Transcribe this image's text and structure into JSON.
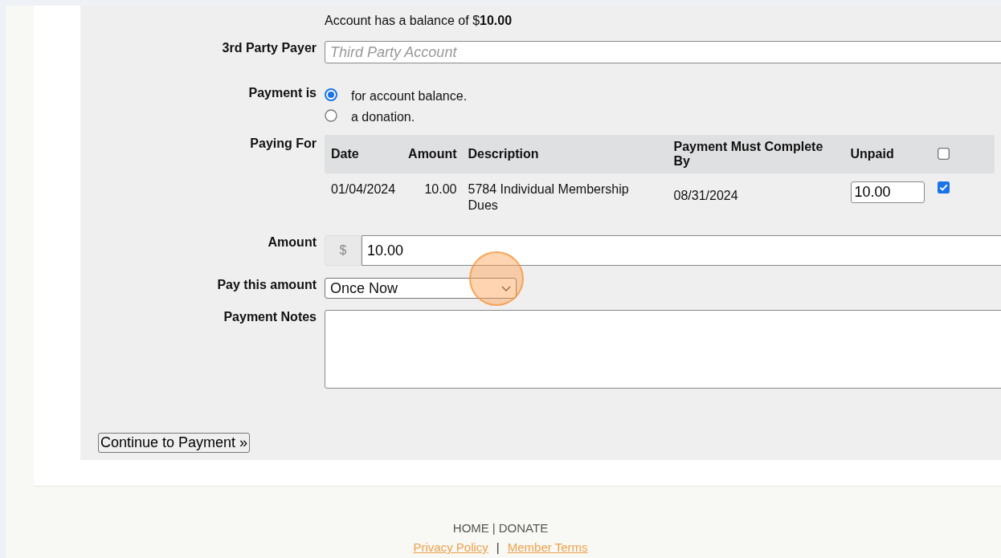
{
  "balance_notice": "Account has a balance of $**10.00**",
  "third_party_payer": {
    "label": "3rd Party Payer",
    "placeholder": "Third Party Account"
  },
  "payment_type": {
    "label": "Payment is",
    "options": [
      {
        "label": "for account balance.",
        "selected": true
      },
      {
        "label": "a donation.",
        "selected": false
      }
    ]
  },
  "paying_for": {
    "label": "Paying For",
    "select_all_checked": false,
    "columns": [
      "Date",
      "Amount",
      "Description",
      "Payment Must Complete By",
      "Unpaid"
    ],
    "rows": [
      {
        "date": "01/04/2024",
        "amount": "10.00",
        "description": "5784 Individual Membership Dues",
        "complete_by": "08/31/2024",
        "unpaid": "10.00",
        "checked": true
      }
    ]
  },
  "amount": {
    "label": "Amount",
    "prefix": "$",
    "value": "10.00"
  },
  "schedule": {
    "label": "Pay this amount",
    "value": "Once Now"
  },
  "notes": {
    "label": "Payment Notes"
  },
  "submit_button": "Continue to Payment »",
  "footer": {
    "lines": [
      [
        {
          "kind": "nav",
          "text": "HOME"
        },
        {
          "kind": "separator",
          "text": "|"
        },
        {
          "kind": "nav",
          "text": "DONATE"
        }
      ],
      [
        {
          "kind": "link",
          "text": "Privacy Policy"
        },
        {
          "kind": "separator",
          "text": "|"
        },
        {
          "kind": "link",
          "text": "Member Terms"
        }
      ]
    ]
  }
}
